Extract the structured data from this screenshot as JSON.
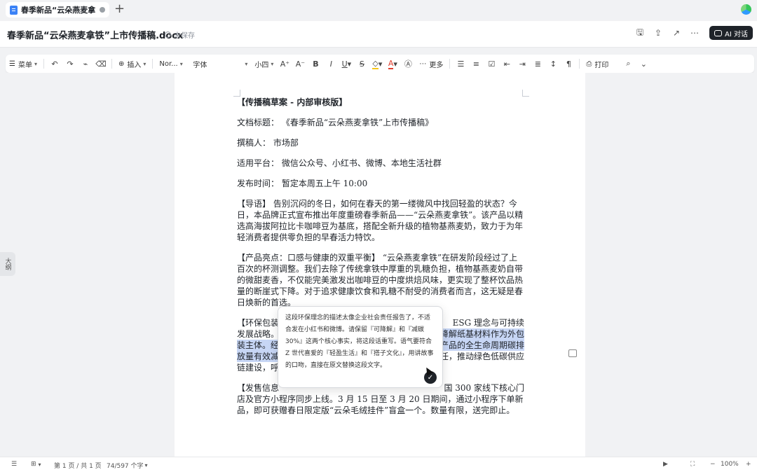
{
  "tab": {
    "title": "春季新品“云朵燕麦拿铁",
    "add_icon": "plus-icon"
  },
  "header": {
    "doc_title": "春季新品“云朵燕麦拿铁”上市传播稿.docx",
    "save_status": "未保存",
    "ai_button": "AI 对话",
    "actions": [
      "save-icon",
      "upload-icon",
      "share-icon",
      "more-icon"
    ]
  },
  "toolbar": {
    "menu": "菜单",
    "insert": "插入",
    "style": "Nor...",
    "font": "字体",
    "size": "小四",
    "grow": "A⁺",
    "shrink": "A⁻",
    "bold": "B",
    "italic": "I",
    "underline": "U",
    "strike": "S",
    "color_letter": "A",
    "more": "更多",
    "print": "打印",
    "accent_color": "#e03e2d",
    "highlight_color": "#f5c518"
  },
  "document": {
    "heading": "【传播稿草案 - 内部审核版】",
    "meta": [
      {
        "label": "文档标题：",
        "value": "《春季新品“云朵燕麦拿铁”上市传播稿》"
      },
      {
        "label": "撰稿人：",
        "value": "市场部"
      },
      {
        "label": "适用平台：",
        "value": "微信公众号、小红书、微博、本地生活社群"
      },
      {
        "label": "发布时间：",
        "value": "暂定本周五上午 10:00"
      }
    ],
    "intro": "【导语】 告别沉闷的冬日，如何在春天的第一缕微风中找回轻盈的状态？今日，本品牌正式宣布推出年度重磅春季新品——“云朵燕麦拿铁”。该产品以精选高海拔阿拉比卡咖啡豆为基底，搭配全新升级的植物基燕麦奶，致力于为年轻消费者提供零负担的早春活力特饮。",
    "highlight": "【产品亮点：口感与健康的双重平衡】 “云朵燕麦拿铁”在研发阶段经过了上百次的杯测调整。我们去除了传统拿铁中厚重的乳糖负担，植物基燕麦奶自带的微甜麦香，不仅能完美激发出咖啡豆的中度烘焙风味，更实现了整杯饮品热量的断崖式下降。对于追求健康饮食和乳糖不耐受的消费者而言，这无疑是春日焕新的首选。",
    "eco_line1_a": "【环保包装",
    "eco_line1_b": "ESG 理念与可持续",
    "eco_line2_a": "发展战略。",
    "eco_line2_b": "降解纸基材料作为外包",
    "eco_line3_a": "装主体。经",
    "eco_line3_b": "产品的全生命周期碳排",
    "eco_line4_a": "放量有效减",
    "eco_line4_b": "任，推动绿色低碳供应",
    "eco_line5_a": "链建设，呼",
    "sale_line1_a": "【发售信息",
    "sale_line1_b": "国 300 家线下核心门",
    "sale_rest": "店及官方小程序同步上线。3 月 15 日至 3 月 20 日期间，通过小程序下单新品，即可获赠春日限定版“云朵毛绒挂件”盲盒一个。数量有限，送完即止。"
  },
  "popup": {
    "text": "这段环保理念的描述太像企业社会责任报告了，不适合发在小红书和微博。请保留『可降解』和『减碳 30%』这两个核心事实，将这段话重写。语气要符合 Z 世代喜爱的『轻盈生活』和『搭子文化』，用讲故事的口吻，直接在原文替换这段文字。",
    "send_icon": "send-icon"
  },
  "sidebar": {
    "outline_label": "大纲"
  },
  "statusbar": {
    "page": "第 1 页 / 共 1 页",
    "words": "74/597 个字",
    "zoom": "100%"
  }
}
